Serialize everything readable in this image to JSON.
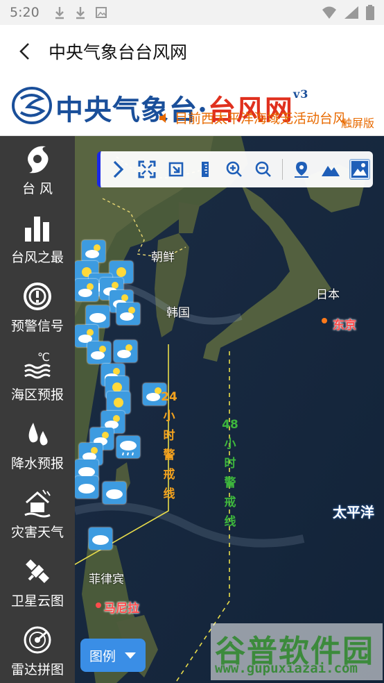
{
  "status_bar": {
    "time": "5:20"
  },
  "app_bar": {
    "title": "中央气象台台风网"
  },
  "banner": {
    "brand_blue": "中央气象台·",
    "brand_red": "台风网",
    "version": "v3",
    "marquee": "目前西太平洋海域无活动台风",
    "touch_label": "触屏版"
  },
  "sidebar": {
    "items": [
      {
        "label": "台 风",
        "icon": "typhoon-icon"
      },
      {
        "label": "台风之最",
        "icon": "bar-chart-icon"
      },
      {
        "label": "预警信号",
        "icon": "warning-signal-icon"
      },
      {
        "label": "海区预报",
        "icon": "sea-forecast-icon"
      },
      {
        "label": "降水预报",
        "icon": "rain-drops-icon"
      },
      {
        "label": "灾害天气",
        "icon": "disaster-house-icon"
      },
      {
        "label": "卫星云图",
        "icon": "satellite-icon"
      },
      {
        "label": "雷达拼图",
        "icon": "radar-icon"
      }
    ]
  },
  "map": {
    "labels": {
      "korea_north": "朝鲜",
      "korea_south": "韩国",
      "japan": "日本",
      "tokyo": "东京",
      "philippines": "菲律宾",
      "manila": "马尼拉",
      "pacific": "太平洋"
    },
    "line_24h": [
      "24",
      "小",
      "时",
      "警",
      "戒",
      "线"
    ],
    "line_48h": [
      "48",
      "小",
      "时",
      "警",
      "戒",
      "线"
    ],
    "sea_temp_label": "℃"
  },
  "legend_button": {
    "label": "图例"
  },
  "watermark": {
    "line1": "谷普软件园",
    "line2": "www.gupuxiazai.com"
  },
  "colors": {
    "sidebar_bg": "#3a3a3a",
    "brand_blue": "#1a4f9a",
    "brand_red": "#e0301e",
    "marquee_orange": "#e86a00",
    "toolbar_accent": "#1a28e8",
    "line_24h": "#f2a11e",
    "line_48h": "#3db53d",
    "legend_bg": "#3a8ee6"
  }
}
